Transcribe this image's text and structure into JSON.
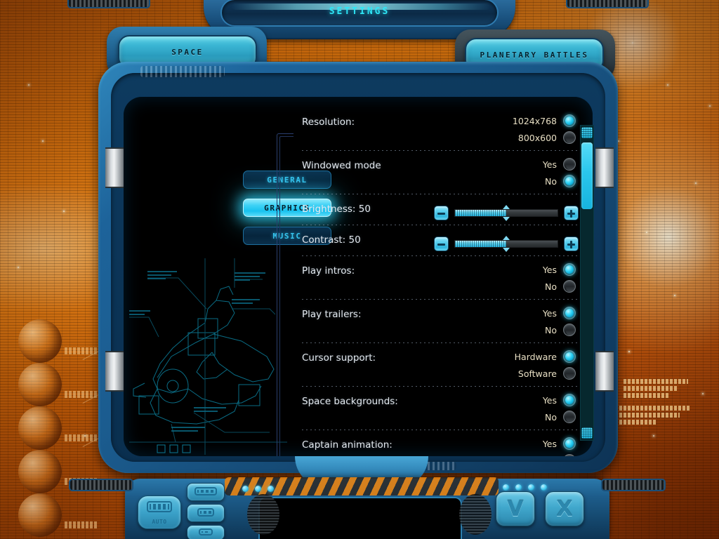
{
  "window": {
    "title": "SETTINGS"
  },
  "tabs": [
    {
      "id": "space",
      "label": "SPACE"
    },
    {
      "id": "planetary",
      "label": "PLANETARY BATTLES"
    }
  ],
  "nav": {
    "items": [
      {
        "id": "general",
        "label": "GENERAL",
        "active": false
      },
      {
        "id": "graphics",
        "label": "GRAPHICS",
        "active": true
      },
      {
        "id": "music",
        "label": "MUSIC",
        "active": false
      }
    ]
  },
  "settings": [
    {
      "id": "resolution",
      "label": "Resolution:",
      "type": "radio",
      "options": [
        {
          "label": "1024x768",
          "selected": true
        },
        {
          "label": "800x600",
          "selected": false
        }
      ]
    },
    {
      "id": "windowed-mode",
      "label": "Windowed mode",
      "type": "radio",
      "options": [
        {
          "label": "Yes",
          "selected": false
        },
        {
          "label": "No",
          "selected": true
        }
      ]
    },
    {
      "id": "brightness",
      "label": "Brightness: 50",
      "type": "slider",
      "value": 50,
      "min": 0,
      "max": 100,
      "decrement": "-",
      "increment": "+"
    },
    {
      "id": "contrast",
      "label": "Contrast: 50",
      "type": "slider",
      "value": 50,
      "min": 0,
      "max": 100,
      "decrement": "-",
      "increment": "+"
    },
    {
      "id": "play-intros",
      "label": "Play intros:",
      "type": "radio",
      "options": [
        {
          "label": "Yes",
          "selected": true
        },
        {
          "label": "No",
          "selected": false
        }
      ]
    },
    {
      "id": "play-trailers",
      "label": "Play trailers:",
      "type": "radio",
      "options": [
        {
          "label": "Yes",
          "selected": true
        },
        {
          "label": "No",
          "selected": false
        }
      ]
    },
    {
      "id": "cursor-support",
      "label": "Cursor support:",
      "type": "radio",
      "options": [
        {
          "label": "Hardware",
          "selected": true
        },
        {
          "label": "Software",
          "selected": false
        }
      ]
    },
    {
      "id": "space-backgrounds",
      "label": "Space backgrounds:",
      "type": "radio",
      "options": [
        {
          "label": "Yes",
          "selected": true
        },
        {
          "label": "No",
          "selected": false
        }
      ]
    },
    {
      "id": "captain-animation",
      "label": "Captain animation:",
      "type": "radio",
      "options": [
        {
          "label": "Yes",
          "selected": true
        },
        {
          "label": "",
          "selected": false
        }
      ]
    }
  ],
  "scrollbar": {
    "up_icon": "scroll-up-icon",
    "down_icon": "scroll-down-icon",
    "thumb_position_percent": 5
  },
  "bottom_bar": {
    "auto_label": "AUTO",
    "confirm_label": "V",
    "cancel_label": "X"
  },
  "colors": {
    "accent_cyan": "#2ac6ec",
    "accent_cyan_bright": "#5fd4f0",
    "panel_blue": "#1d639a",
    "background_orange": "#d4700d",
    "option_text": "#e8dfc4",
    "label_text": "#e3e9ef"
  }
}
